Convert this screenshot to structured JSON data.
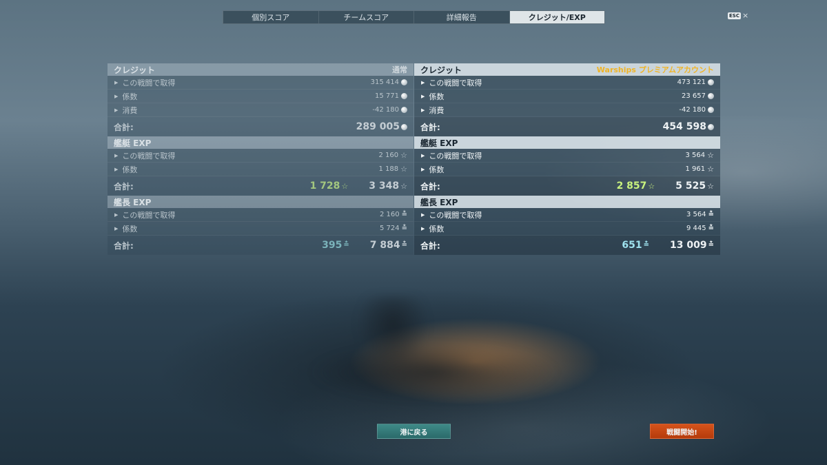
{
  "tabs": [
    "個別スコア",
    "チームスコア",
    "詳細報告",
    "クレジット/EXP"
  ],
  "active_tab": 3,
  "esc_badge": "ESC",
  "close_label": "×",
  "left": {
    "credits_title": "クレジット",
    "credits_tag": "通常",
    "credits_rows": [
      {
        "label": "この戦闘で取得",
        "value": "315 414"
      },
      {
        "label": "係数",
        "value": "15 771"
      },
      {
        "label": "消費",
        "value": "-42 180"
      }
    ],
    "credits_total_label": "合計:",
    "credits_total": "289 005",
    "ship_exp_title": "艦艇 EXP",
    "ship_exp_rows": [
      {
        "label": "この戦闘で取得",
        "value": "2 160"
      },
      {
        "label": "係数",
        "value": "1 188"
      }
    ],
    "ship_exp_total_label": "合計:",
    "ship_exp_elite": "1 728",
    "ship_exp_total": "3 348",
    "cap_exp_title": "艦長 EXP",
    "cap_exp_rows": [
      {
        "label": "この戦闘で取得",
        "value": "2 160"
      },
      {
        "label": "係数",
        "value": "5 724"
      }
    ],
    "cap_exp_total_label": "合計:",
    "cap_exp_elite": "395",
    "cap_exp_total": "7 884"
  },
  "right": {
    "credits_title": "クレジット",
    "credits_tag": "Warships プレミアムアカウント",
    "credits_rows": [
      {
        "label": "この戦闘で取得",
        "value": "473 121"
      },
      {
        "label": "係数",
        "value": "23 657"
      },
      {
        "label": "消費",
        "value": "-42 180"
      }
    ],
    "credits_total_label": "合計:",
    "credits_total": "454 598",
    "ship_exp_title": "艦艇 EXP",
    "ship_exp_rows": [
      {
        "label": "この戦闘で取得",
        "value": "3 564"
      },
      {
        "label": "係数",
        "value": "1 961"
      }
    ],
    "ship_exp_total_label": "合計:",
    "ship_exp_elite": "2 857",
    "ship_exp_total": "5 525",
    "cap_exp_title": "艦長 EXP",
    "cap_exp_rows": [
      {
        "label": "この戦闘で取得",
        "value": "3 564"
      },
      {
        "label": "係数",
        "value": "9 445"
      }
    ],
    "cap_exp_total_label": "合計:",
    "cap_exp_elite": "651",
    "cap_exp_total": "13 009"
  },
  "buttons": {
    "back_to_port": "港に戻る",
    "start_battle": "戦闘開始!"
  },
  "icons": {
    "credit": "credit-coin-icon",
    "ship_exp": "star-icon",
    "captain_exp": "anchor-bars-icon"
  },
  "colors": {
    "premium_gold": "#f0b426",
    "elite_green": "#c9f27e",
    "captain_cyan": "#9fe3ef",
    "port_button": "#2f7373",
    "battle_button": "#c8481a"
  }
}
